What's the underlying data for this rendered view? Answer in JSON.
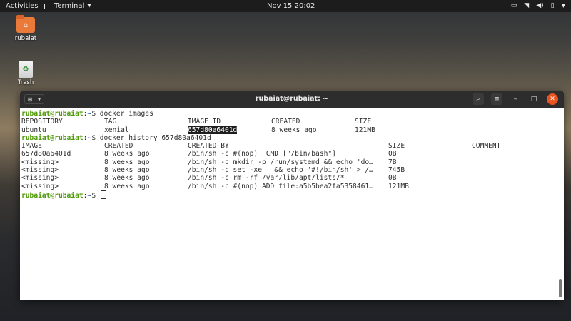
{
  "topbar": {
    "activities": "Activities",
    "app_name": "Terminal",
    "clock": "Nov 15  20:02"
  },
  "desktop": {
    "home_folder_label": "rubaiat",
    "trash_label": "Trash"
  },
  "window": {
    "title": "rubaiat@rubaiat: ~"
  },
  "terminal": {
    "prompt_user": "rubaiat@rubaiat",
    "prompt_path": "~",
    "cmd1": "docker images",
    "images_headers": [
      "REPOSITORY",
      "TAG",
      "IMAGE ID",
      "CREATED",
      "SIZE"
    ],
    "images_rows": [
      [
        "ubuntu",
        "xenial",
        "657d80a6401d",
        "8 weeks ago",
        "121MB"
      ]
    ],
    "cmd2": "docker history 657d80a6401d",
    "history_headers": [
      "IMAGE",
      "CREATED",
      "CREATED BY",
      "SIZE",
      "COMMENT"
    ],
    "history_rows": [
      [
        "657d80a6401d",
        "8 weeks ago",
        "/bin/sh -c #(nop)  CMD [\"/bin/bash\"]",
        "0B",
        ""
      ],
      [
        "<missing>",
        "8 weeks ago",
        "/bin/sh -c mkdir -p /run/systemd && echo 'do…",
        "7B",
        ""
      ],
      [
        "<missing>",
        "8 weeks ago",
        "/bin/sh -c set -xe   && echo '#!/bin/sh' > /…",
        "745B",
        ""
      ],
      [
        "<missing>",
        "8 weeks ago",
        "/bin/sh -c rm -rf /var/lib/apt/lists/*",
        "0B",
        ""
      ],
      [
        "<missing>",
        "8 weeks ago",
        "/bin/sh -c #(nop) ADD file:a5b5bea2fa5358461…",
        "121MB",
        ""
      ]
    ]
  },
  "colors": {
    "prompt_user": "#4e9a06",
    "prompt_path": "#3465a4",
    "close_button": "#e95420"
  }
}
